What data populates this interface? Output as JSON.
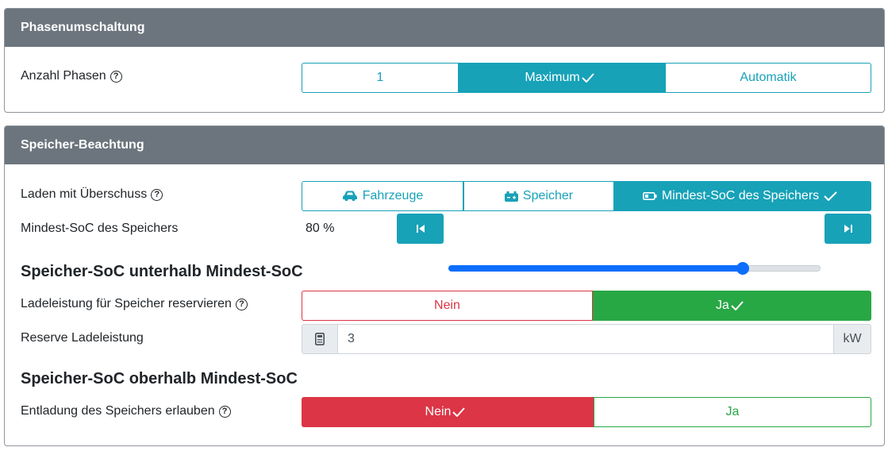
{
  "phase_card": {
    "title": "Phasenumschaltung",
    "anzahl_label": "Anzahl Phasen",
    "options": [
      "1",
      "Maximum",
      "Automatik"
    ],
    "selected": "Maximum"
  },
  "storage_card": {
    "title": "Speicher-Beachtung",
    "surplus_label": "Laden mit Überschuss",
    "surplus_options": [
      {
        "label": "Fahrzeuge",
        "icon": "car-icon"
      },
      {
        "label": "Speicher",
        "icon": "battery-icon"
      },
      {
        "label": "Mindest-SoC des Speichers",
        "icon": "battery-low-icon"
      }
    ],
    "surplus_selected": "Mindest-SoC des Speichers",
    "min_soc_label": "Mindest-SoC des Speichers",
    "min_soc_value": "80 %",
    "min_soc_fraction": 0.79,
    "below_title": "Speicher-SoC unterhalb Mindest-SoC",
    "reserve_label": "Ladeleistung für Speicher reservieren",
    "reserve_options": [
      "Nein",
      "Ja"
    ],
    "reserve_selected": "Ja",
    "reserve_power_label": "Reserve Ladeleistung",
    "reserve_power_value": "3",
    "reserve_power_unit": "kW",
    "above_title": "Speicher-SoC oberhalb Mindest-SoC",
    "discharge_label": "Entladung des Speichers erlauben",
    "discharge_options": [
      "Nein",
      "Ja"
    ],
    "discharge_selected": "Nein"
  },
  "colors": {
    "teal": "#17a2b8",
    "header_gray": "#6c757d",
    "red": "#dc3545",
    "green": "#28a745",
    "slider_blue": "#0d6efd"
  }
}
